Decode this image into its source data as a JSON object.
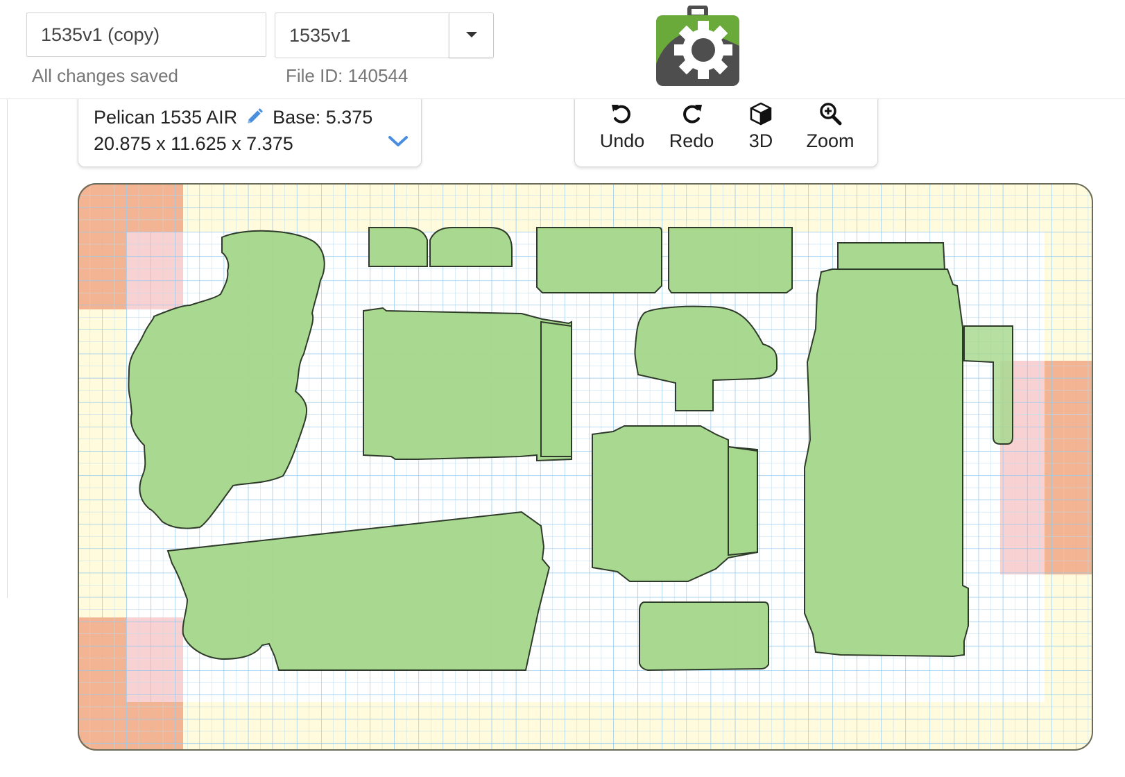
{
  "header": {
    "layout_name": "1535v1 (copy)",
    "version_selected": "1535v1",
    "save_status": "All changes saved",
    "file_id": "File ID: 140544"
  },
  "case_info": {
    "name": "Pelican 1535 AIR",
    "base": "Base: 5.375",
    "dimensions": "20.875 x 11.625 x 7.375"
  },
  "toolbar": {
    "undo_label": "Undo",
    "redo_label": "Redo",
    "view3d_label": "3D",
    "zoom_label": "Zoom"
  },
  "icons": {
    "logo": "green-camera-gear-logo",
    "edit": "pencil-icon",
    "expand": "chevron-down-icon",
    "undo": "undo-icon",
    "redo": "redo-icon",
    "view3d": "cube-icon",
    "zoom": "zoom-in-icon"
  },
  "colors": {
    "cutout_fill": "#a6d88c",
    "cutout_stroke": "#2f3b2a",
    "grid_line": "#b9dcf2",
    "grid_major": "#8fc5ec",
    "border_zone": "#fffbdc",
    "corner_zone": "#f8d2d2",
    "corner_strong": "#f3b493",
    "logo_green": "#6aaa3b",
    "logo_dark": "#4e4e4e",
    "accent_blue": "#4a8ee0"
  }
}
